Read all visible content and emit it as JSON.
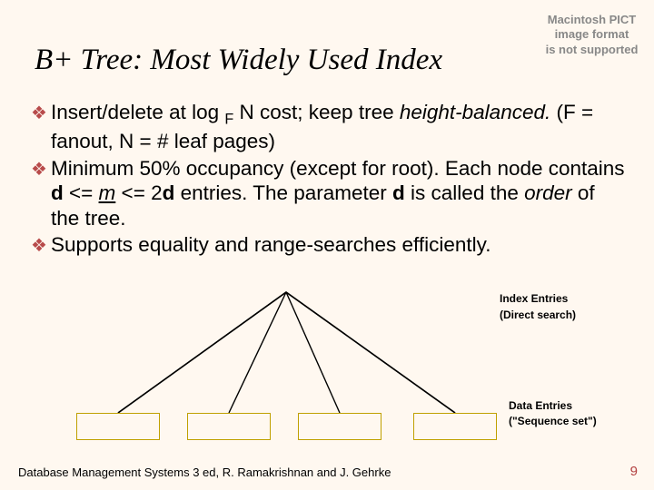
{
  "pict": {
    "l1": "Macintosh PICT",
    "l2": "image format",
    "l3": "is not supported"
  },
  "title": "B+ Tree: Most Widely Used Index",
  "bullets": {
    "mark": "❖",
    "b1": {
      "pre": "Insert/delete at log ",
      "sub": "F",
      "mid": " N cost; keep tree ",
      "ital": "height-balanced.",
      "tail": "   (F = fanout, N = # leaf pages)"
    },
    "b2": {
      "pre": "Minimum 50% occupancy (except for root).  Each node contains ",
      "d1": "d",
      "mid1": " <=  ",
      "m": "m",
      "mid2": "  <= 2",
      "d2": "d",
      "mid3": " entries.  The parameter ",
      "d3": "d",
      "mid4": " is called the ",
      "order": "order",
      "tail": " of the tree."
    },
    "b3": "Supports equality and range-searches efficiently."
  },
  "labels": {
    "index_entries": "Index Entries",
    "direct_search": "(Direct search)",
    "data_entries": "Data Entries",
    "sequence_set": "(\"Sequence set\")"
  },
  "footer": {
    "left": "Database Management Systems 3 ed,  R. Ramakrishnan and J. Gehrke",
    "right": "9"
  }
}
